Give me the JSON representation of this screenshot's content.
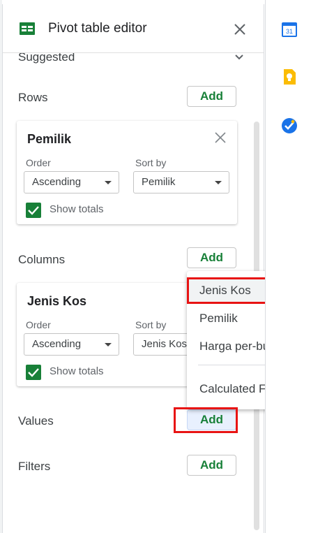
{
  "header": {
    "title": "Pivot table editor",
    "icon": "sheets-icon",
    "close_icon": "close-icon"
  },
  "suggested": {
    "label": "Suggested"
  },
  "rows": {
    "label": "Rows",
    "add_label": "Add",
    "card": {
      "title": "Pemilik",
      "order_label": "Order",
      "order_value": "Ascending",
      "sort_label": "Sort by",
      "sort_value": "Pemilik",
      "show_totals_label": "Show totals",
      "show_totals_checked": true
    }
  },
  "columns": {
    "label": "Columns",
    "add_label": "Add",
    "card": {
      "title": "Jenis Kos",
      "order_label": "Order",
      "order_value": "Ascending",
      "sort_label": "Sort by",
      "sort_value": "Jenis Kos",
      "show_totals_label": "Show totals",
      "show_totals_checked": true
    }
  },
  "values": {
    "label": "Values",
    "add_label": "Add"
  },
  "filters": {
    "label": "Filters",
    "add_label": "Add"
  },
  "dropdown_menu": {
    "items": [
      "Jenis Kos",
      "Pemilik",
      "Harga per-bulan"
    ],
    "calculated_field": "Calculated Field"
  },
  "side_panel": {
    "calendar_day": "31",
    "icons": [
      "calendar-icon",
      "keep-icon",
      "tasks-icon"
    ]
  },
  "colors": {
    "accent_green": "#188038",
    "highlight_red": "#e81414",
    "menu_selected": "#f1f3f4",
    "add_focus": "#e8f0fe"
  }
}
